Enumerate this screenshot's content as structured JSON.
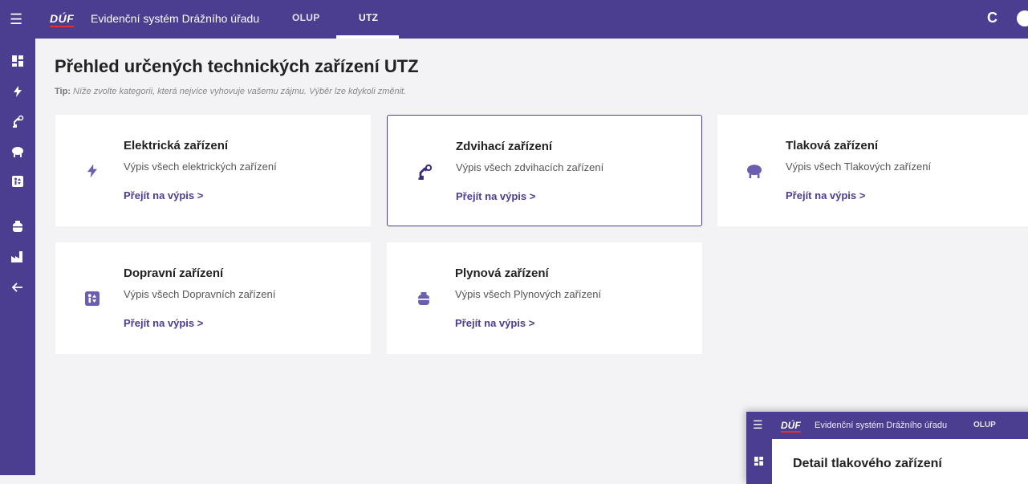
{
  "header": {
    "logo": "DÚF",
    "app_title": "Evidenční systém Drážního úřadu",
    "tabs": [
      {
        "label": "OLUP"
      },
      {
        "label": "UTZ",
        "active": true
      }
    ],
    "icons": [
      "menu-icon",
      "refresh-icon",
      "user-icon"
    ]
  },
  "sidebar": {
    "items": [
      {
        "icon": "dashboard-icon"
      },
      {
        "icon": "bolt-icon"
      },
      {
        "icon": "crane-icon"
      },
      {
        "icon": "pressure-tank-icon"
      },
      {
        "icon": "elevator-icon"
      },
      {
        "icon": "gas-cylinder-icon"
      },
      {
        "icon": "factory-icon"
      },
      {
        "icon": "back-arrow-icon"
      }
    ]
  },
  "main": {
    "title": "Přehled určených technických zařízení UTZ",
    "tip_label": "Tip:",
    "tip_text": "Níže zvolte kategorii, která nejvíce vyhovuje vašemu zájmu. Výběr lze kdykoli změnit."
  },
  "cards": [
    {
      "title": "Elektrická zařízení",
      "description": "Výpis všech elektrických zařízení",
      "link": "Přejít na výpis  >",
      "icon": "bolt-icon"
    },
    {
      "title": "Zdvihací zařízení",
      "description": "Výpis všech zdvihacích zařízení",
      "link": "Přejít na výpis  >",
      "icon": "crane-icon",
      "selected": true
    },
    {
      "title": "Tlaková zařízení",
      "description": "Výpis všech Tlakových zařízení",
      "link": "Přejít na výpis  >",
      "icon": "pressure-tank-icon"
    },
    {
      "title": "Dopravní zařízení",
      "description": "Výpis všech Dopravních zařízení",
      "link": "Přejít na výpis  >",
      "icon": "elevator-icon"
    },
    {
      "title": "Plynová zařízení",
      "description": "Výpis všech Plynových zařízení",
      "link": "Přejít na výpis  >",
      "icon": "gas-cylinder-icon"
    }
  ],
  "overlay": {
    "logo": "DÚF",
    "app_title": "Evidenční systém Drážního úřadu",
    "tab": "OLUP",
    "heading": "Detail tlakového zařízení"
  },
  "colors": {
    "brand": "#4b3d8f",
    "background": "#f3f3f5",
    "card": "#ffffff",
    "accent_red": "#e03131"
  }
}
